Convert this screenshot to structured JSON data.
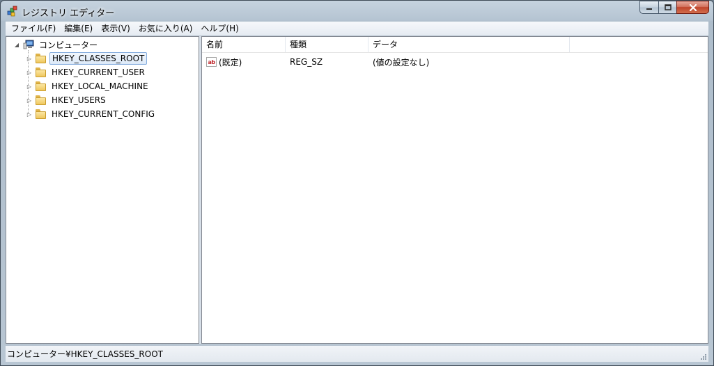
{
  "window": {
    "title": "レジストリ エディター"
  },
  "menu": [
    {
      "label": "ファイル(F)"
    },
    {
      "label": "編集(E)"
    },
    {
      "label": "表示(V)"
    },
    {
      "label": "お気に入り(A)"
    },
    {
      "label": "ヘルプ(H)"
    }
  ],
  "tree": {
    "root": {
      "label": "コンピューター",
      "expanded": true
    },
    "items": [
      {
        "label": "HKEY_CLASSES_ROOT",
        "selected": true
      },
      {
        "label": "HKEY_CURRENT_USER"
      },
      {
        "label": "HKEY_LOCAL_MACHINE"
      },
      {
        "label": "HKEY_USERS"
      },
      {
        "label": "HKEY_CURRENT_CONFIG"
      }
    ]
  },
  "list": {
    "columns": [
      "名前",
      "種類",
      "データ"
    ],
    "rows": [
      {
        "name": "(既定)",
        "type": "REG_SZ",
        "data": "(値の設定なし)",
        "icon": "string-value-icon"
      }
    ]
  },
  "status": {
    "path": "コンピューター¥HKEY_CLASSES_ROOT"
  },
  "colors": {
    "selection_border": "#84acdd",
    "close_button": "#c0442b"
  }
}
